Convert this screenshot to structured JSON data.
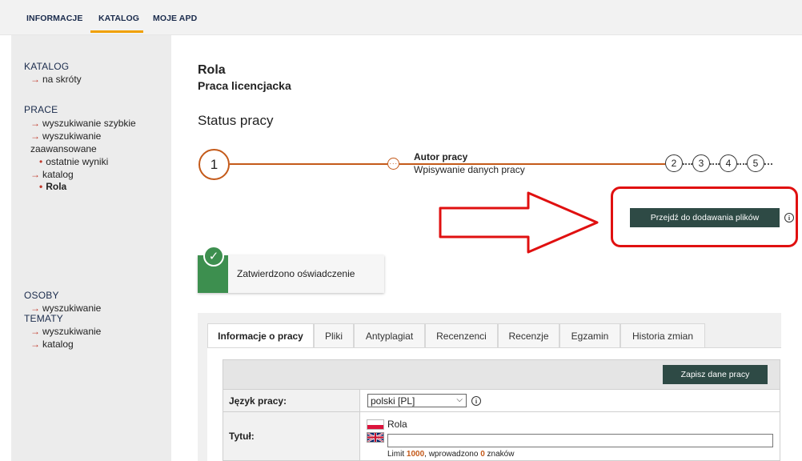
{
  "topnav": {
    "items": [
      "INFORMACJE",
      "KATALOG",
      "MOJE APD"
    ],
    "active": "KATALOG",
    "accent_color": "#f0a000"
  },
  "sidebar": {
    "katalog": {
      "heading": "KATALOG",
      "links": [
        "na skróty"
      ]
    },
    "prace": {
      "heading": "PRACE",
      "link1": "wyszukiwanie szybkie",
      "link2_line1": "wyszukiwanie",
      "link2_line2": "zaawansowane",
      "bullet1": "ostatnie wyniki",
      "link3": "katalog",
      "bullet2": "Rola"
    },
    "osoby": {
      "heading": "OSOBY",
      "links": [
        "wyszukiwanie"
      ]
    },
    "tematy": {
      "heading": "TEMATY",
      "links": [
        "wyszukiwanie",
        "katalog"
      ]
    }
  },
  "main": {
    "title": "Rola",
    "subtitle": "Praca licencjacka",
    "section_title": "Status pracy"
  },
  "stepper": {
    "current_step": "1",
    "current_title": "Autor pracy",
    "current_subtitle": "Wpisywanie danych pracy",
    "current_icon": "ellipsis-icon",
    "next_steps": [
      "2",
      "3",
      "4",
      "5"
    ],
    "line_color": "#c45a1a"
  },
  "actions": {
    "go_to_files_label": "Przejdź do dodawania plików",
    "save_label": "Zapisz dane pracy",
    "button_color": "#2e4a45",
    "annotation_color": "#e01010"
  },
  "confirmation": {
    "text": "Zatwierdzono oświadczenie",
    "icon": "check-icon",
    "color": "#3d8f4f"
  },
  "tabs": [
    {
      "label": "Informacje o pracy",
      "active": true
    },
    {
      "label": "Pliki",
      "active": false
    },
    {
      "label": "Antyplagiat",
      "active": false
    },
    {
      "label": "Recenzenci",
      "active": false
    },
    {
      "label": "Recenzje",
      "active": false
    },
    {
      "label": "Egzamin",
      "active": false
    },
    {
      "label": "Historia zmian",
      "active": false
    }
  ],
  "form": {
    "language_label": "Język pracy:",
    "language_value": "polski [PL]",
    "title_label": "Tytuł:",
    "title_pl_value": "Rola",
    "title_en_value": "",
    "limit_prefix": "Limit ",
    "limit_value": "1000",
    "limit_middle": ", wprowadzono ",
    "limit_entered": "0",
    "limit_suffix": " znaków"
  }
}
